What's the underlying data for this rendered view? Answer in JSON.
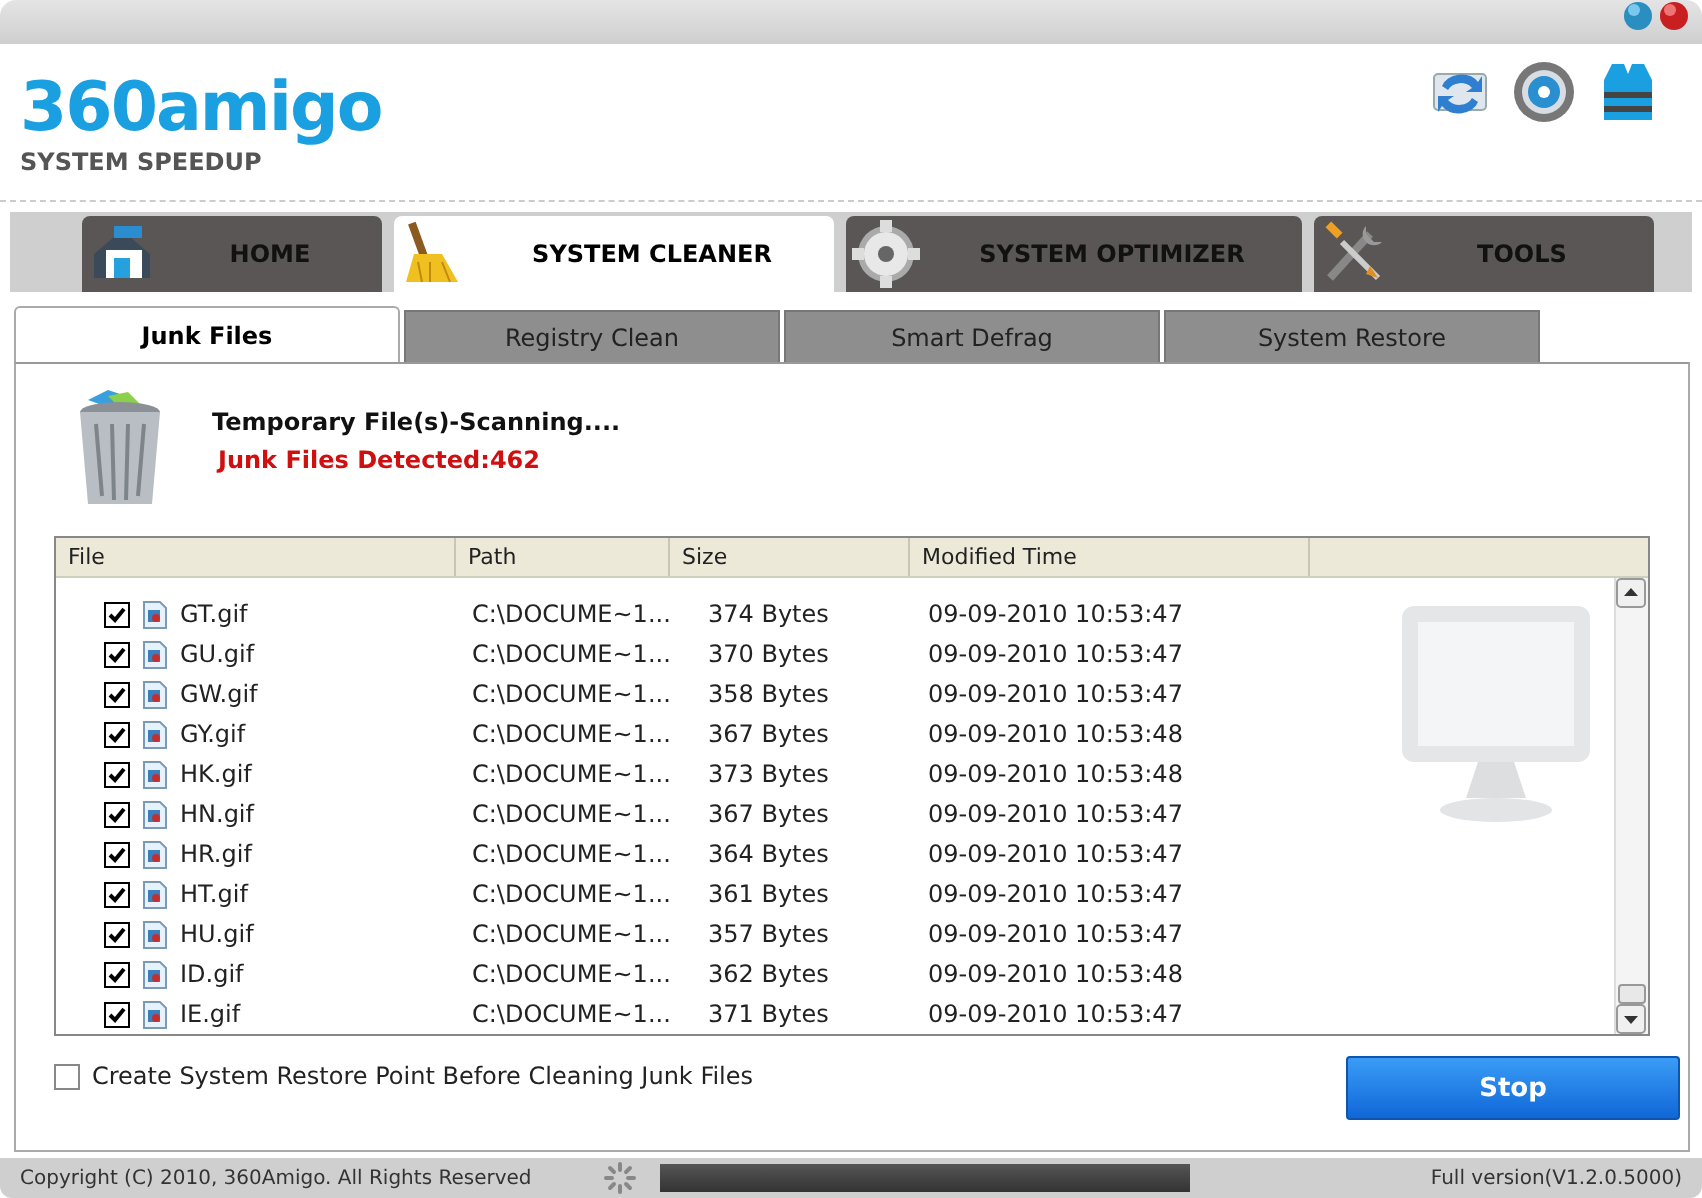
{
  "logo": {
    "name": "360amigo",
    "tagline": "SYSTEM SPEEDUP"
  },
  "nav_tabs": [
    {
      "label": "HOME",
      "kind": "house",
      "selected": false
    },
    {
      "label": "SYSTEM CLEANER",
      "kind": "broom",
      "selected": true
    },
    {
      "label": "SYSTEM OPTIMIZER",
      "kind": "gear",
      "selected": false
    },
    {
      "label": "TOOLS",
      "kind": "tools",
      "selected": false
    }
  ],
  "sub_tabs": [
    {
      "label": "Junk Files",
      "selected": true
    },
    {
      "label": "Registry Clean",
      "selected": false
    },
    {
      "label": "Smart Defrag",
      "selected": false
    },
    {
      "label": "System Restore",
      "selected": false
    }
  ],
  "scan": {
    "title": "Temporary File(s)-Scanning....",
    "detected": "Junk Files Detected:462"
  },
  "table": {
    "columns": [
      "File",
      "Path",
      "Size",
      "Modified Time"
    ],
    "rows": [
      {
        "file": "GT.gif",
        "path": "C:\\DOCUME~1...",
        "size": "374 Bytes",
        "modified": "09-09-2010 10:53:47",
        "checked": true
      },
      {
        "file": "GU.gif",
        "path": "C:\\DOCUME~1...",
        "size": "370 Bytes",
        "modified": "09-09-2010 10:53:47",
        "checked": true
      },
      {
        "file": "GW.gif",
        "path": "C:\\DOCUME~1...",
        "size": "358 Bytes",
        "modified": "09-09-2010 10:53:47",
        "checked": true
      },
      {
        "file": "GY.gif",
        "path": "C:\\DOCUME~1...",
        "size": "367 Bytes",
        "modified": "09-09-2010 10:53:48",
        "checked": true
      },
      {
        "file": "HK.gif",
        "path": "C:\\DOCUME~1...",
        "size": "373 Bytes",
        "modified": "09-09-2010 10:53:48",
        "checked": true
      },
      {
        "file": "HN.gif",
        "path": "C:\\DOCUME~1...",
        "size": "367 Bytes",
        "modified": "09-09-2010 10:53:47",
        "checked": true
      },
      {
        "file": "HR.gif",
        "path": "C:\\DOCUME~1...",
        "size": "364 Bytes",
        "modified": "09-09-2010 10:53:47",
        "checked": true
      },
      {
        "file": "HT.gif",
        "path": "C:\\DOCUME~1...",
        "size": "361 Bytes",
        "modified": "09-09-2010 10:53:47",
        "checked": true
      },
      {
        "file": "HU.gif",
        "path": "C:\\DOCUME~1...",
        "size": "357 Bytes",
        "modified": "09-09-2010 10:53:47",
        "checked": true
      },
      {
        "file": "ID.gif",
        "path": "C:\\DOCUME~1...",
        "size": "362 Bytes",
        "modified": "09-09-2010 10:53:48",
        "checked": true
      },
      {
        "file": "IE.gif",
        "path": "C:\\DOCUME~1...",
        "size": "371 Bytes",
        "modified": "09-09-2010 10:53:47",
        "checked": true
      }
    ]
  },
  "restore_point": {
    "label": "Create System Restore Point Before Cleaning Junk Files",
    "checked": false
  },
  "stop_button": "Stop",
  "status_bar": {
    "copyright": "Copyright (C) 2010, 360Amigo. All Rights Reserved",
    "progress": {
      "level": 1
    },
    "version": "Full version(V1.2.0.5000)"
  }
}
